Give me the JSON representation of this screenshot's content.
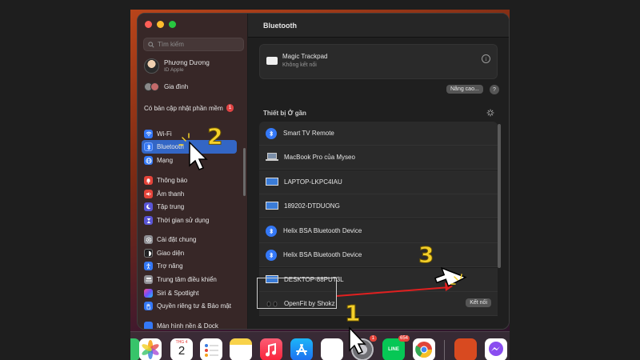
{
  "sidebar": {
    "search_placeholder": "Tìm kiếm",
    "profile_name": "Phương Dương",
    "profile_sub": "ID Apple",
    "family": "Gia đình",
    "update_text": "Có bản cập nhật phần mềm",
    "update_badge": "1",
    "items": [
      {
        "label": "Wi-Fi",
        "icon": "wifi-icon",
        "color": "#3478f6"
      },
      {
        "label": "Bluetooth",
        "icon": "bluetooth-icon",
        "color": "#3478f6"
      },
      {
        "label": "Mạng",
        "icon": "globe-icon",
        "color": "#3478f6"
      },
      {
        "label": "Thông báo",
        "icon": "bell-icon",
        "color": "#e5443a"
      },
      {
        "label": "Âm thanh",
        "icon": "speaker-icon",
        "color": "#e5443a"
      },
      {
        "label": "Tập trung",
        "icon": "moon-icon",
        "color": "#5a55d6"
      },
      {
        "label": "Thời gian sử dụng",
        "icon": "hourglass-icon",
        "color": "#5a55d6"
      },
      {
        "label": "Cài đặt chung",
        "icon": "gear-icon",
        "color": "#8e8e93"
      },
      {
        "label": "Giao diện",
        "icon": "appearance-icon",
        "color": "#1c1c1e"
      },
      {
        "label": "Trợ năng",
        "icon": "accessibility-icon",
        "color": "#3478f6"
      },
      {
        "label": "Trung tâm điều khiển",
        "icon": "control-center-icon",
        "color": "#8e8e93"
      },
      {
        "label": "Siri & Spotlight",
        "icon": "siri-icon",
        "color": "#b24fd6"
      },
      {
        "label": "Quyền riêng tư & Bảo mật",
        "icon": "hand-icon",
        "color": "#3478f6"
      },
      {
        "label": "Màn hình nền & Dock",
        "icon": "dock-icon",
        "color": "#3478f6"
      }
    ]
  },
  "main": {
    "title": "Bluetooth",
    "trackpad_name": "Magic Trackpad",
    "trackpad_status": "Không kết nối",
    "advanced_button": "Nâng cao...",
    "help_button": "?",
    "nearby_header": "Thiết bị Ở gần",
    "devices": [
      {
        "name": "Smart TV Remote",
        "icon": "bluetooth-icon"
      },
      {
        "name": "MacBook Pro của Myseo",
        "icon": "laptop-icon"
      },
      {
        "name": "LAPTOP-LKPC4IAU",
        "icon": "monitor-icon"
      },
      {
        "name": "189202-DTDUONG",
        "icon": "monitor-icon"
      },
      {
        "name": "Helix BSA Bluetooth Device",
        "icon": "bluetooth-icon"
      },
      {
        "name": "Helix BSA Bluetooth Device",
        "icon": "bluetooth-icon"
      },
      {
        "name": "DESKTOP-88PUT3L",
        "icon": "monitor-icon"
      },
      {
        "name": "OpenFit by Shokz",
        "icon": "earbuds-icon"
      }
    ],
    "connect_button": "Kết nối"
  },
  "annotations": {
    "step1": "1",
    "step2": "2",
    "step3": "3",
    "accent": "#f4d02a",
    "arrow_color": "#e02020"
  },
  "dock": {
    "calendar_month": "THG 4",
    "calendar_day": "2",
    "settings_badge": "1",
    "line_badge": "654",
    "line_label": "LINE"
  }
}
